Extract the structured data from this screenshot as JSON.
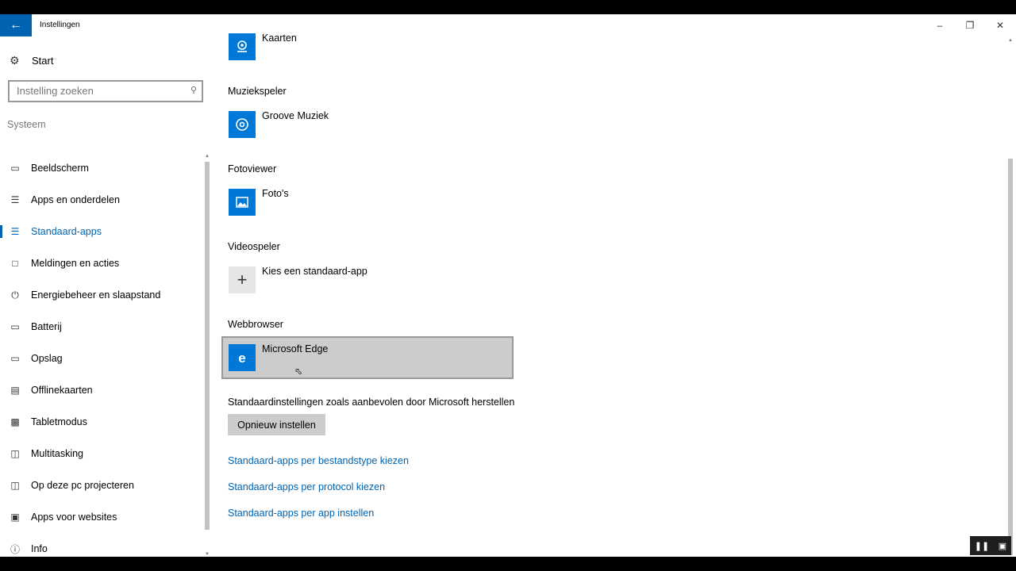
{
  "window": {
    "title": "Instellingen"
  },
  "icons": {
    "back": "back-arrow-icon",
    "minimize": "minimize-icon",
    "restore": "restore-icon",
    "close": "close-icon",
    "gear": "gear-icon",
    "search": "search-icon"
  },
  "sidebar": {
    "home_label": "Start",
    "search_placeholder": "Instelling zoeken",
    "section_title": "Systeem",
    "items": [
      {
        "label": "Beeldscherm",
        "icon": "monitor-icon"
      },
      {
        "label": "Apps en onderdelen",
        "icon": "list-icon"
      },
      {
        "label": "Standaard-apps",
        "icon": "default-apps-icon",
        "active": true
      },
      {
        "label": "Meldingen en acties",
        "icon": "notification-icon"
      },
      {
        "label": "Energiebeheer en slaapstand",
        "icon": "power-icon"
      },
      {
        "label": "Batterij",
        "icon": "battery-icon"
      },
      {
        "label": "Opslag",
        "icon": "storage-icon"
      },
      {
        "label": "Offlinekaarten",
        "icon": "map-icon"
      },
      {
        "label": "Tabletmodus",
        "icon": "tablet-icon"
      },
      {
        "label": "Multitasking",
        "icon": "multitasking-icon"
      },
      {
        "label": "Op deze pc projecteren",
        "icon": "project-icon"
      },
      {
        "label": "Apps voor websites",
        "icon": "web-apps-icon"
      },
      {
        "label": "Info",
        "icon": "info-icon"
      }
    ]
  },
  "main": {
    "maps_app": "Kaarten",
    "music": {
      "heading": "Muziekspeler",
      "app": "Groove Muziek"
    },
    "photo": {
      "heading": "Fotoviewer",
      "app": "Foto's"
    },
    "video": {
      "heading": "Videospeler",
      "app": "Kies een standaard-app"
    },
    "web": {
      "heading": "Webbrowser",
      "app": "Microsoft Edge"
    },
    "reset_description": "Standaardinstellingen zoals aanbevolen door Microsoft herstellen",
    "reset_button": "Opnieuw instellen",
    "links": [
      "Standaard-apps per bestandstype kiezen",
      "Standaard-apps per protocol kiezen",
      "Standaard-apps per app instellen"
    ]
  },
  "colors": {
    "accent": "#0063b1",
    "tile": "#0078d7",
    "selected_bg": "#cccccc"
  }
}
